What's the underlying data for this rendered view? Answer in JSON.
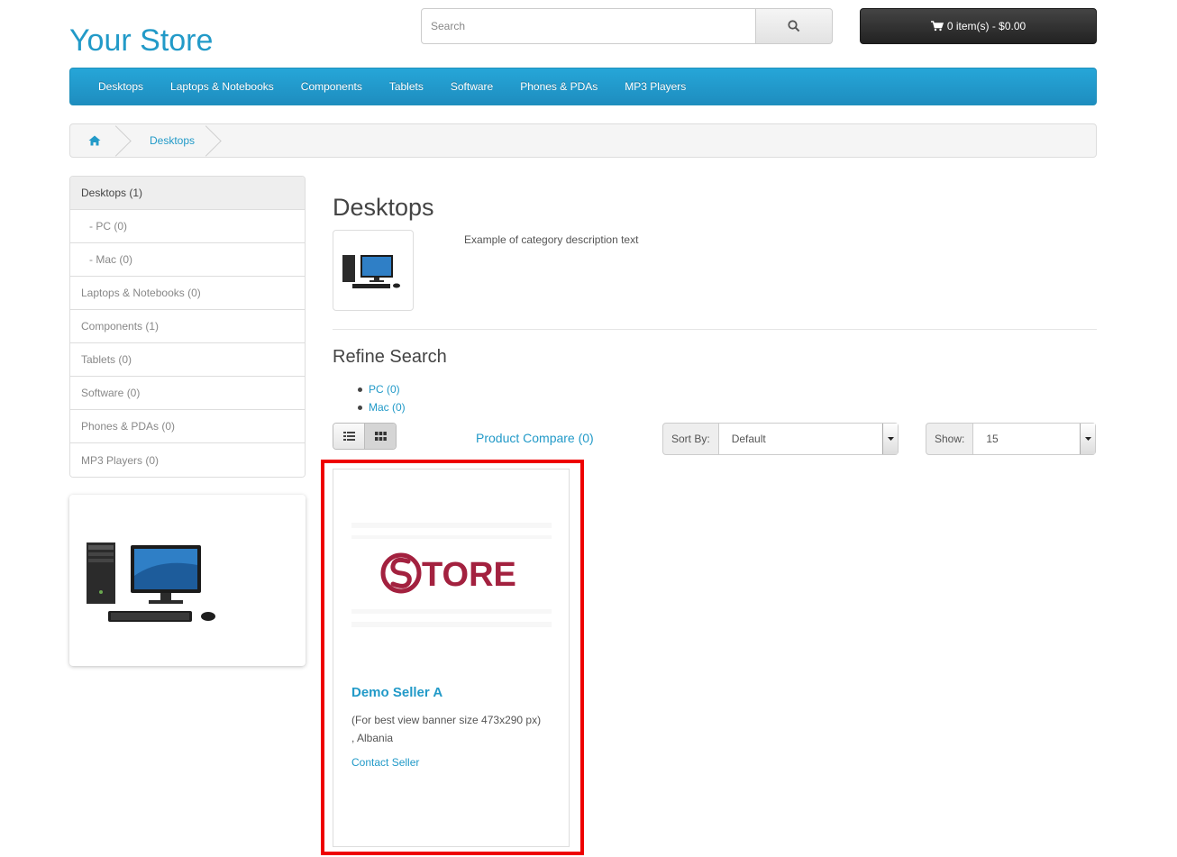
{
  "header": {
    "logo": "Your Store",
    "search_placeholder": "Search",
    "cart_label": "0 item(s) - $0.00"
  },
  "menu": {
    "items": [
      "Desktops",
      "Laptops & Notebooks",
      "Components",
      "Tablets",
      "Software",
      "Phones & PDAs",
      "MP3 Players"
    ]
  },
  "breadcrumb": {
    "items": [
      "Desktops"
    ]
  },
  "sidebar": {
    "items": [
      {
        "label": "Desktops (1)",
        "active": true
      },
      {
        "label": "- PC (0)",
        "sub": true
      },
      {
        "label": "- Mac (0)",
        "sub": true
      },
      {
        "label": "Laptops & Notebooks (0)"
      },
      {
        "label": "Components (1)"
      },
      {
        "label": "Tablets (0)"
      },
      {
        "label": "Software (0)"
      },
      {
        "label": "Phones & PDAs (0)"
      },
      {
        "label": "MP3 Players (0)"
      }
    ]
  },
  "category": {
    "title": "Desktops",
    "description": "Example of category description text"
  },
  "refine": {
    "title": "Refine Search",
    "links": [
      "PC (0)",
      "Mac (0)"
    ]
  },
  "toolbar": {
    "compare_label": "Product Compare (0)",
    "sort_label": "Sort By:",
    "sort_value": "Default",
    "show_label": "Show:",
    "show_value": "15"
  },
  "seller": {
    "banner_text": "TORE",
    "name": "Demo Seller A",
    "description": "(For best view banner size 473x290 px)",
    "location": ", Albania",
    "contact_label": "Contact Seller"
  },
  "colors": {
    "accent": "#229ac8",
    "highlight": "#ee0000",
    "store_logo": "#a3213f"
  }
}
